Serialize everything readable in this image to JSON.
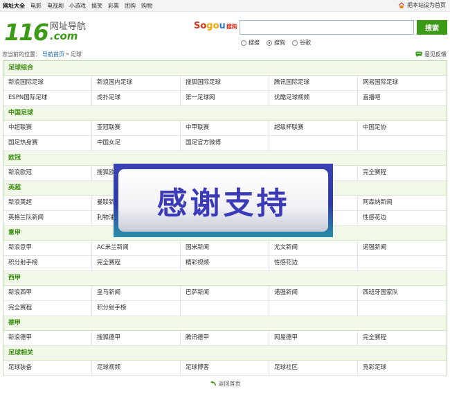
{
  "topbar": {
    "nav": [
      "网址大全",
      "电影",
      "电视剧",
      "小游戏",
      "搞笑",
      "彩票",
      "团购",
      "购物"
    ],
    "sethome": "把本站设为首页"
  },
  "logo": {
    "number": "116",
    "cn": "网址导航",
    "com": ".com"
  },
  "search": {
    "brand_so": "So",
    "brand_go": "go",
    "brand_u": "u",
    "brand_cn": "搜狗",
    "value": "",
    "button": "搜索",
    "engines": [
      {
        "label": "搜搜",
        "checked": false
      },
      {
        "label": "搜狗",
        "checked": true
      },
      {
        "label": "谷歌",
        "checked": false
      }
    ]
  },
  "breadcrumb": {
    "prefix": "您当前的位置：",
    "home": "导航首页",
    "sep": "»",
    "current": "足球"
  },
  "feedback": "意见反馈",
  "sections": [
    {
      "title": "足球综合",
      "rows": [
        [
          "新浪国际足球",
          "新浪国内足球",
          "搜狐国际足球",
          "腾讯国际足球",
          "网易国际足球"
        ],
        [
          "ESPN国际足球",
          "虎扑足球",
          "第一足球网",
          "优酷足球视频",
          "直播吧"
        ]
      ]
    },
    {
      "title": "中国足球",
      "rows": [
        [
          "中超联赛",
          "亚冠联赛",
          "中甲联赛",
          "超级杯联赛",
          "中国足协"
        ],
        [
          "国足热身赛",
          "中国女足",
          "国足官方微博",
          "",
          ""
        ]
      ]
    },
    {
      "title": "欧冠",
      "rows": [
        [
          "新浪欧冠",
          "搜狐欧",
          "",
          "",
          "完全赛程"
        ]
      ]
    },
    {
      "title": "英超",
      "rows": [
        [
          "新浪英超",
          "曼联新",
          "",
          "",
          "阿森纳新闻"
        ],
        [
          "英格兰队新闻",
          "利物浦",
          "",
          "",
          "性感花边"
        ]
      ]
    },
    {
      "title": "意甲",
      "rows": [
        [
          "新浪意甲",
          "AC米兰新闻",
          "国米新闻",
          "尤文新闻",
          "诺强新闻"
        ],
        [
          "积分射手榜",
          "完全赛程",
          "精彩视频",
          "性感花边",
          ""
        ]
      ]
    },
    {
      "title": "西甲",
      "rows": [
        [
          "新浪西甲",
          "皇马新闻",
          "巴萨新闻",
          "诺强新闻",
          "西班牙国家队"
        ],
        [
          "完全赛程",
          "积分射手榜",
          "",
          "",
          ""
        ]
      ]
    },
    {
      "title": "德甲",
      "rows": [
        [
          "新浪德甲",
          "搜狐德甲",
          "腾讯德甲",
          "网易德甲",
          "完全赛程"
        ]
      ]
    },
    {
      "title": "足球相关",
      "rows": [
        [
          "足球装备",
          "足球视频",
          "足球博客",
          "足球社区",
          "竞彩足球"
        ]
      ]
    }
  ],
  "footer": {
    "back": "返回首页"
  },
  "overlay": {
    "text": "感谢支持"
  },
  "colors": {
    "brand_green": "#3c9a16",
    "section_title": "#3c8f10",
    "overlay_blue": "#3b3bb8"
  }
}
